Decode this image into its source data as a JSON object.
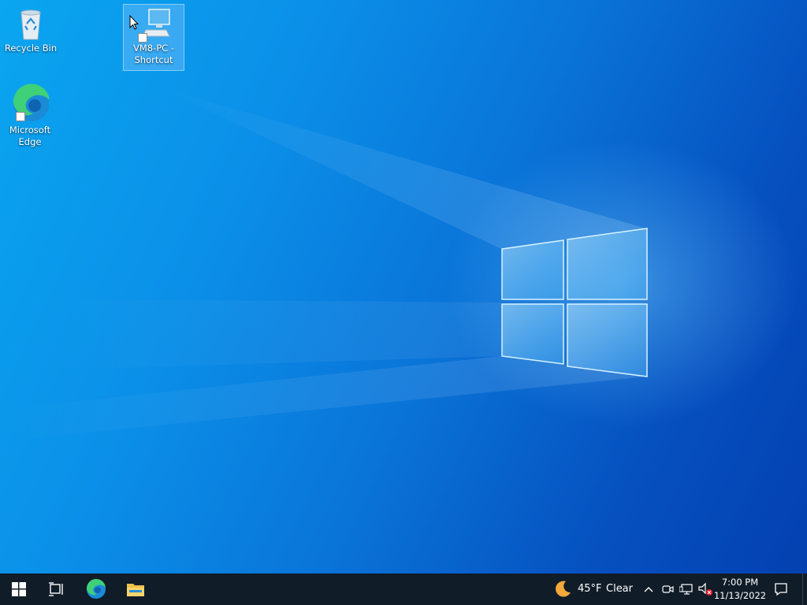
{
  "desktop": {
    "icons": [
      {
        "label": "Recycle Bin",
        "icon": "recycle-bin-icon"
      },
      {
        "label": "Microsoft Edge",
        "icon": "edge-icon"
      },
      {
        "label": "VM8-PC - Shortcut",
        "icon": "computer-shortcut-icon",
        "selected": true
      }
    ]
  },
  "taskbar": {
    "start": {
      "icon": "windows-logo-icon"
    },
    "pinned": [
      {
        "icon": "task-view-icon"
      },
      {
        "icon": "edge-icon"
      },
      {
        "icon": "file-explorer-icon"
      }
    ],
    "weather": {
      "icon": "moon-icon",
      "temperature": "45°F",
      "condition": "Clear"
    },
    "tray_icons": [
      "chevron-up-icon",
      "meet-now-icon",
      "network-icon",
      "volume-muted-icon"
    ],
    "clock": {
      "time": "7:00 PM",
      "date": "11/13/2022"
    },
    "notifications": {
      "icon": "action-center-icon"
    }
  },
  "colors": {
    "taskbar": "#101c28",
    "accent": "#0a74d8"
  }
}
